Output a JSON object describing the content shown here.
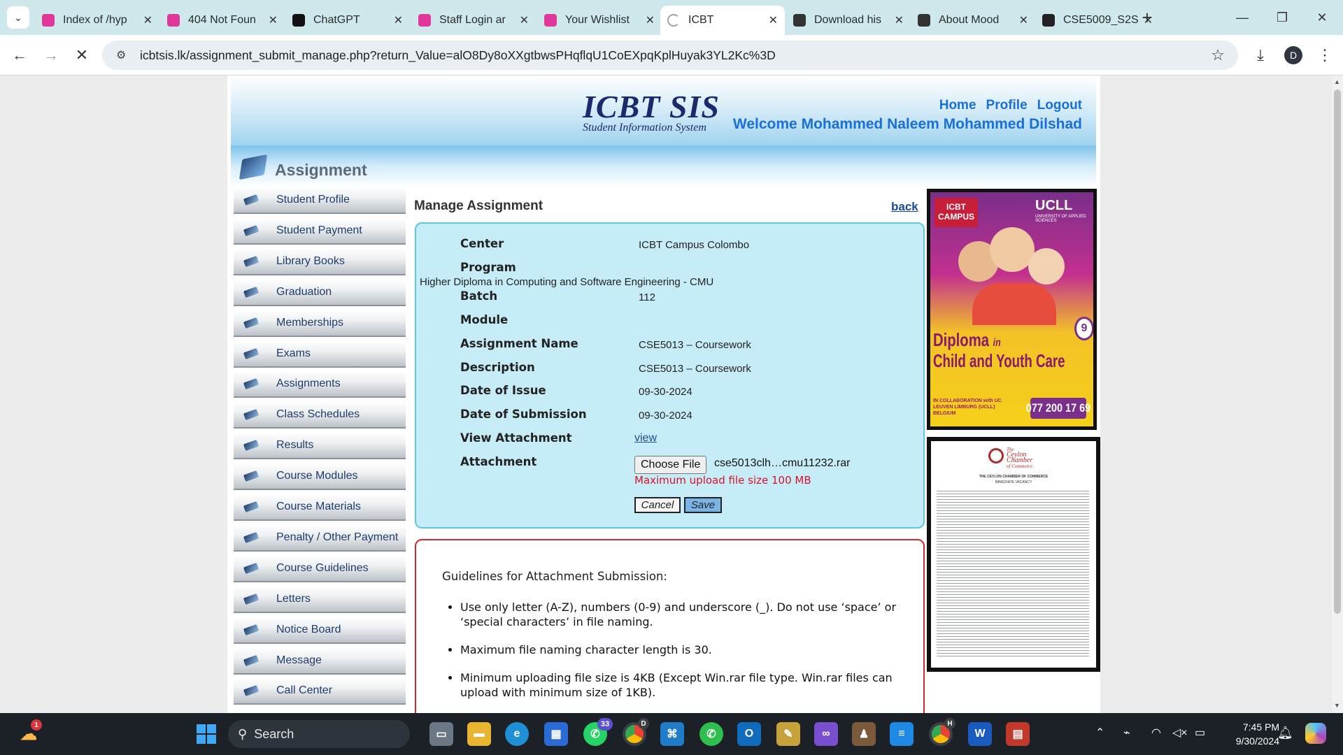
{
  "browser": {
    "tabs": [
      {
        "title": "Index of /hyp",
        "icon": "moodle-icon",
        "color": "#e0379a"
      },
      {
        "title": "404 Not Foun",
        "icon": "moodle-icon",
        "color": "#e0379a"
      },
      {
        "title": "ChatGPT",
        "icon": "chatgpt-icon",
        "color": "#111111"
      },
      {
        "title": "Staff Login ar",
        "icon": "moodle-icon",
        "color": "#e0379a"
      },
      {
        "title": "Your Wishlist",
        "icon": "moodle-icon",
        "color": "#e0379a"
      },
      {
        "title": "ICBT",
        "icon": "loading-icon",
        "color": "#9aa4ad",
        "active": true
      },
      {
        "title": "Download his",
        "icon": "download-icon",
        "color": "#333333"
      },
      {
        "title": "About Mood",
        "icon": "document-icon",
        "color": "#333333"
      },
      {
        "title": "CSE5009_S2S",
        "icon": "moodle-m-icon",
        "color": "#222222"
      }
    ],
    "url": "icbtsis.lk/assignment_submit_manage.php?return_Value=alO8Dy8oXXgtbwsPHqflqU1CoEXpqKplHuyak3YL2Kc%3D",
    "profile_initial": "D"
  },
  "site": {
    "logo_title": "ICBT SIS",
    "logo_subtitle": "Student Information System",
    "nav": {
      "home": "Home",
      "profile": "Profile",
      "logout": "Logout"
    },
    "welcome": "Welcome Mohammed Naleem Mohammed Dilshad",
    "section_title": "Assignment"
  },
  "sidebar": {
    "items": [
      "Student Profile",
      "Student Payment",
      "Library Books",
      "Graduation",
      "Memberships",
      "Exams",
      "Assignments",
      "Class Schedules",
      "Results",
      "Course Modules",
      "Course Materials",
      "Penalty / Other Payment",
      "Course Guidelines",
      "Letters",
      "Notice Board",
      "Message",
      "Call Center"
    ]
  },
  "main": {
    "title": "Manage Assignment",
    "back": "back",
    "labels": {
      "center": "Center",
      "program": "Program",
      "batch": "Batch",
      "module": "Module",
      "assignment_name": "Assignment Name",
      "description": "Description",
      "date_of_issue": "Date of Issue",
      "date_of_submission": "Date of Submission",
      "view_attachment": "View Attachment",
      "attachment": "Attachment"
    },
    "values": {
      "center": "ICBT Campus Colombo",
      "program": "Higher Diploma in Computing and Software Engineering - CMU",
      "batch": "112",
      "module": "",
      "assignment_name": "CSE5013 – Coursework",
      "description": "CSE5013 – Coursework",
      "date_of_issue": "09-30-2024",
      "date_of_submission": "09-30-2024",
      "view_link": "view",
      "choose_file": "Choose File",
      "file_name": "cse5013clh…cmu11232.rar"
    },
    "max_upload": "Maximum upload file size 100 MB",
    "cancel": "Cancel",
    "save": "Save"
  },
  "guidelines": {
    "title": "Guidelines for Attachment Submission:",
    "items": [
      "Use only letter (A-Z), numbers (0-9) and underscore (_). Do not use ‘space’ or ‘special characters’ in file naming.",
      "Maximum file naming character length is 30.",
      "Minimum uploading file size is 4KB (Except Win.rar file type. Win.rar files can upload with minimum size of 1KB)."
    ]
  },
  "ads": {
    "ad1": {
      "left_brand": "ICBT CAMPUS",
      "right_brand": "UCLL",
      "right_sub": "UNIVERSITY OF APPLIED SCIENCES",
      "headline_1": "Diploma",
      "headline_in": "in",
      "headline_2": "Child and Youth Care",
      "collab": "IN COLLABORATION with UC LEUVEN LIMBURG (UCLL) BELGIUM",
      "badge": "9",
      "phone": "077 200 17 69"
    },
    "ad2": {
      "org_1": "The",
      "org_2": "Ceylon",
      "org_3": "Chamber",
      "org_4": "of Commerce",
      "heading": "THE CEYLON CHAMBER OF COMMERCE",
      "subheading": "IMMEDIATE VACANCY"
    }
  },
  "taskbar": {
    "search": "Search",
    "time": "7:45 PM",
    "date": "9/30/2024",
    "weather_badge": "1",
    "whatsapp_badge": "33",
    "chrome_badge": "D",
    "chrome2_badge": "H"
  }
}
